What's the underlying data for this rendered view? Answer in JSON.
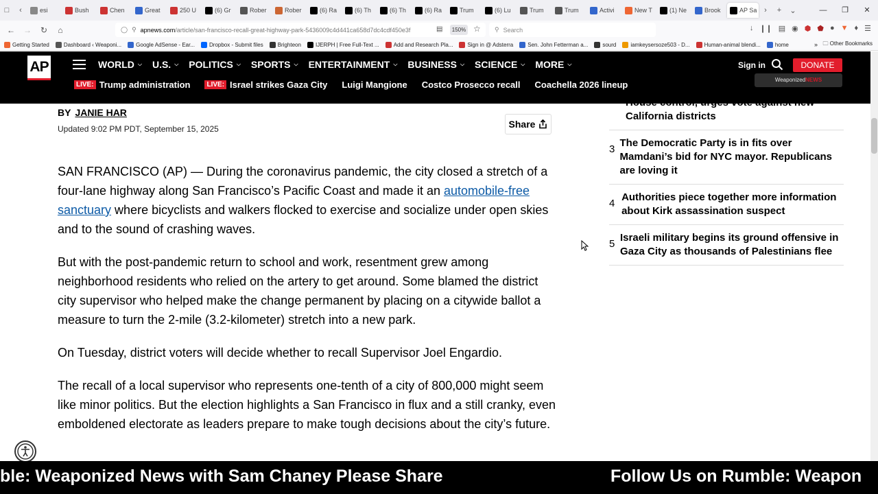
{
  "browser": {
    "tabs": [
      {
        "label": "esi",
        "color": "#888"
      },
      {
        "label": "Bush",
        "color": "#c33"
      },
      {
        "label": "Chen",
        "color": "#c33"
      },
      {
        "label": "Great",
        "color": "#36c"
      },
      {
        "label": "250 U",
        "color": "#c33"
      },
      {
        "label": "(6) Gr",
        "color": "#000"
      },
      {
        "label": "Rober",
        "color": "#555"
      },
      {
        "label": "Rober",
        "color": "#c63"
      },
      {
        "label": "(6) Ra",
        "color": "#000"
      },
      {
        "label": "(6) Th",
        "color": "#000"
      },
      {
        "label": "(6) Th",
        "color": "#000"
      },
      {
        "label": "(6) Ra",
        "color": "#000"
      },
      {
        "label": "Trum",
        "color": "#000"
      },
      {
        "label": "(6) Lu",
        "color": "#000"
      },
      {
        "label": "Trum",
        "color": "#555"
      },
      {
        "label": "Trum",
        "color": "#555"
      },
      {
        "label": "Activi",
        "color": "#36c"
      },
      {
        "label": "New T",
        "color": "#e63"
      },
      {
        "label": "(1) Ne",
        "color": "#000"
      },
      {
        "label": "Brook",
        "color": "#36c"
      },
      {
        "label": "AP Sa",
        "color": "#000"
      }
    ],
    "url_domain": "apnews.com",
    "url_rest": "/article/san-francisco-recall-great-highway-park-5436009c4d441ca658d7dc4cdf450e3f",
    "zoom": "150%",
    "search_placeholder": "Search",
    "bookmarks": [
      {
        "label": "Getting Started",
        "color": "#e63"
      },
      {
        "label": "Dashboard ‹ Weaponi...",
        "color": "#555"
      },
      {
        "label": "Google AdSense - Ear...",
        "color": "#36c"
      },
      {
        "label": "Dropbox - Submit files",
        "color": "#06f"
      },
      {
        "label": "Brighteon",
        "color": "#333"
      },
      {
        "label": "IJERPH | Free Full-Text ...",
        "color": "#000"
      },
      {
        "label": "Add and Research Pla...",
        "color": "#c33"
      },
      {
        "label": "Sign in @ Adsterra",
        "color": "#c33"
      },
      {
        "label": "Sen. John Fetterman a...",
        "color": "#36c"
      },
      {
        "label": "sourd",
        "color": "#333"
      },
      {
        "label": "iamkeysersoze503 - D...",
        "color": "#e90"
      },
      {
        "label": "Human-animal blendi...",
        "color": "#c33"
      },
      {
        "label": "home",
        "color": "#36c"
      }
    ],
    "other_bookmarks": "Other Bookmarks"
  },
  "header": {
    "logo": "AP",
    "nav": [
      "WORLD",
      "U.S.",
      "POLITICS",
      "SPORTS",
      "ENTERTAINMENT",
      "BUSINESS",
      "SCIENCE",
      "MORE"
    ],
    "signin": "Sign in",
    "donate": "DONATE",
    "watermark_a": "Weaponized",
    "watermark_b": "NEWS",
    "live_label": "LIVE:",
    "trending": [
      {
        "live": true,
        "label": "Trump administration"
      },
      {
        "live": true,
        "label": "Israel strikes Gaza City"
      },
      {
        "live": false,
        "label": "Luigi Mangione"
      },
      {
        "live": false,
        "label": "Costco Prosecco recall"
      },
      {
        "live": false,
        "label": "Coachella 2026 lineup"
      }
    ]
  },
  "article": {
    "by": "BY",
    "author": "JANIE HAR",
    "updated": "Updated 9:02 PM PDT, September 15, 2025",
    "share": "Share",
    "p1_a": "SAN FRANCISCO (AP) — During the coronavirus pandemic, the city closed a stretch of a four-lane highway along San Francisco’s Pacific Coast and made it an ",
    "p1_link": "automobile-free sanctuary",
    "p1_b": " where bicyclists and walkers flocked to exercise and socialize under open skies and to the sound of crashing waves.",
    "p2": "But with the post-pandemic return to school and work, resentment grew among neighborhood residents who relied on the artery to get around. Some blamed the district city supervisor who helped make the change permanent by placing on a citywide ballot a measure to turn the 2-mile (3.2-kilometer) stretch into a new park.",
    "p3": "On Tuesday, district voters will decide whether to recall Supervisor Joel Engardio.",
    "p4": "The recall of a local supervisor who represents one-tenth of a city of 800,000 might seem like minor politics. But the election highlights a San Francisco in flux and a still cranky, even emboldened electorate as leaders prepare to make tough decisions about the city’s future."
  },
  "sidebar": {
    "top_partial": "House control, urges vote against new California districts",
    "items": [
      {
        "num": "3",
        "title": "The Democratic Party is in fits over Mamdani’s bid for NYC mayor. Republicans are loving it"
      },
      {
        "num": "4",
        "title": "Authorities piece together more information about Kirk assassination suspect"
      },
      {
        "num": "5",
        "title": "Israeli military begins its ground offensive in Gaza City as thousands of Palestinians flee"
      }
    ]
  },
  "ticker": {
    "text1": "ble: Weaponized News with Sam Chaney Please Share",
    "text2": "Follow Us on Rumble: Weapon"
  }
}
